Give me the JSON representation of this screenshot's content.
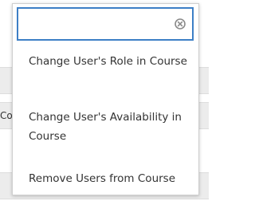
{
  "search": {
    "value": "",
    "placeholder": ""
  },
  "icons": {
    "clear": "clear-circle-x-icon"
  },
  "background": {
    "partial_text": "Co"
  },
  "menu": {
    "items": [
      {
        "label": "Change User's Role in Course"
      },
      {
        "label": "Change User's Availability in Course"
      },
      {
        "label": "Remove Users from Course"
      }
    ]
  },
  "colors": {
    "focus_border": "#3d7fc6",
    "text": "#333333",
    "clear_icon": "#8a8a8a"
  }
}
